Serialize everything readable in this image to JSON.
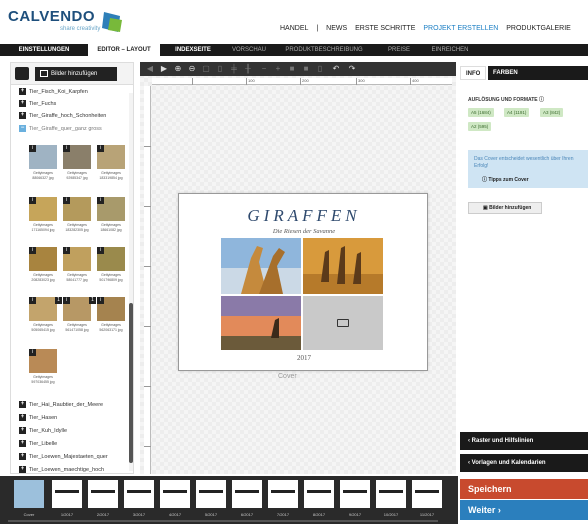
{
  "brand": {
    "name": "CALVENDO",
    "tagline": "share creativity"
  },
  "topnav": [
    "HANDEL",
    "|",
    "NEWS",
    "ERSTE SCHRITTE",
    "PROJEKT ERSTELLEN",
    "PRODUKTGALERIE"
  ],
  "topnav_active": "PROJEKT ERSTELLEN",
  "tabs": [
    "EINSTELLUNGEN",
    "EDITOR – LAYOUT",
    "INDEXSEITE",
    "VORSCHAU",
    "PRODUKTBESCHREIBUNG",
    "PREISE",
    "EINREICHEN"
  ],
  "left": {
    "add_images_label": "Bilder hinzufügen",
    "folders_top": [
      "Tier_Fisch_Koi_Karpfen",
      "Tier_Fuchs",
      "Tier_Giraffe_hoch_Schonheiten",
      "Tier_Giraffe_quer_ganz gross"
    ],
    "thumb_captions": [
      "Gettyimages 88066327 jpg",
      "Gettyimages 92985347 jpg",
      "Gettyimages 183319854 jpg",
      "Gettyimages 171165094 jpg",
      "Gettyimages 183282305 jpg",
      "Gettyimages 18661082 jpg",
      "Gettyimages 208283023 jpg",
      "Gettyimages 58041777 jpg",
      "Gettyimages 501796809 jpg",
      "Gettyimages 505065415 jpg",
      "Gettyimages 561471058 jpg",
      "Gettyimages 562063171 jpg",
      "Gettyimages 597036455 jpg"
    ],
    "badges": [
      "1",
      "1"
    ],
    "folders_bottom": [
      "Tier_Hai_Raubtier_der_Meere",
      "Tier_Hasen",
      "Tier_Kuh_Idylle",
      "Tier_Libelle",
      "Tier_Loewen_Majestaeten_quer",
      "Tier_Loewen_maechtige_hoch"
    ]
  },
  "ruler": [
    "100",
    "200",
    "300",
    "400"
  ],
  "calendar": {
    "title": "GIRAFFEN",
    "subtitle": "Die Riesen der Savanne",
    "year": "2017",
    "page_label": "Cover"
  },
  "right": {
    "tab_info": "INFO",
    "tab_farben": "FARBEN",
    "section_title": "AUFLÖSUNG UND FORMATE",
    "formats": [
      "A5 (1684)",
      "A4 (1191)",
      "A3 (842)",
      "A2 (595)"
    ],
    "infobox_text": "Das Cover entscheidet wesentlich über Ihren Erfolg!",
    "tips_label": "Tipps zum Cover",
    "add_images_label": "Bilder hinzufügen",
    "accordion": [
      "Raster und Hilfslinien",
      "Vorlagen und Kalendarien"
    ],
    "save_label": "Speichern",
    "next_label": "Weiter"
  },
  "filmstrip": [
    "Cover",
    "1/2017",
    "2/2017",
    "3/2017",
    "4/2017",
    "5/2017",
    "6/2017",
    "7/2017",
    "8/2017",
    "9/2017",
    "10/2017",
    "11/2017"
  ]
}
